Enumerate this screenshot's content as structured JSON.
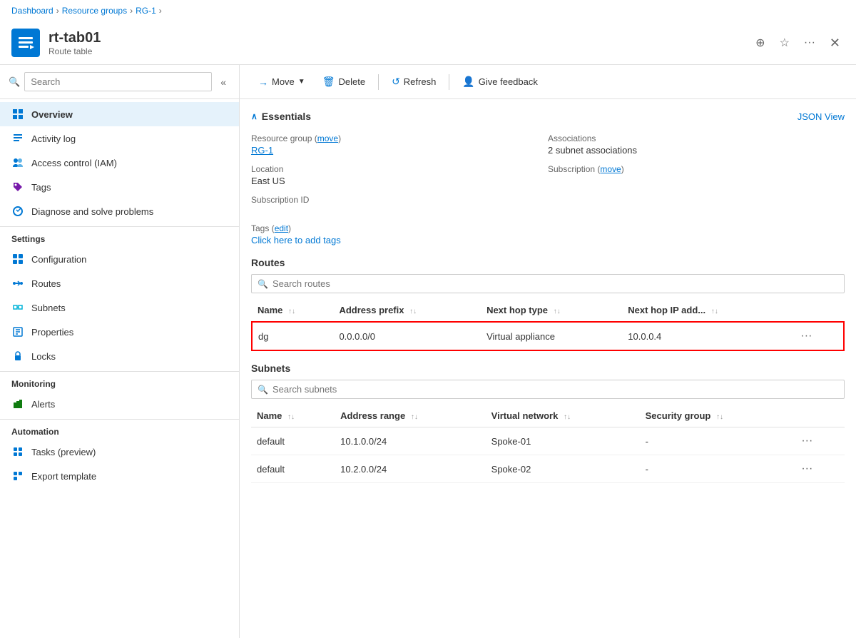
{
  "breadcrumb": {
    "items": [
      "Dashboard",
      "Resource groups",
      "RG-1"
    ],
    "separator": "›"
  },
  "resource": {
    "title": "rt-tab01",
    "subtitle": "Route table",
    "icon": "🗺"
  },
  "header_icons": {
    "favorite": "☆",
    "pin": "★",
    "ellipsis": "···",
    "close": "✕"
  },
  "toolbar": {
    "move_label": "Move",
    "delete_label": "Delete",
    "refresh_label": "Refresh",
    "feedback_label": "Give feedback"
  },
  "search": {
    "placeholder": "Search"
  },
  "sidebar": {
    "items": [
      {
        "id": "overview",
        "label": "Overview",
        "icon": "grid",
        "active": true
      },
      {
        "id": "activity-log",
        "label": "Activity log",
        "icon": "list"
      },
      {
        "id": "access-control",
        "label": "Access control (IAM)",
        "icon": "people"
      },
      {
        "id": "tags",
        "label": "Tags",
        "icon": "tag"
      },
      {
        "id": "diagnose",
        "label": "Diagnose and solve problems",
        "icon": "wrench"
      }
    ],
    "settings_label": "Settings",
    "settings_items": [
      {
        "id": "configuration",
        "label": "Configuration",
        "icon": "config"
      },
      {
        "id": "routes",
        "label": "Routes",
        "icon": "routes"
      },
      {
        "id": "subnets",
        "label": "Subnets",
        "icon": "subnet"
      },
      {
        "id": "properties",
        "label": "Properties",
        "icon": "properties"
      },
      {
        "id": "locks",
        "label": "Locks",
        "icon": "lock"
      }
    ],
    "monitoring_label": "Monitoring",
    "monitoring_items": [
      {
        "id": "alerts",
        "label": "Alerts",
        "icon": "alert"
      }
    ],
    "automation_label": "Automation",
    "automation_items": [
      {
        "id": "tasks",
        "label": "Tasks (preview)",
        "icon": "tasks"
      },
      {
        "id": "export",
        "label": "Export template",
        "icon": "export"
      }
    ]
  },
  "essentials": {
    "section_title": "Essentials",
    "json_view": "JSON View",
    "resource_group_label": "Resource group (move)",
    "resource_group_value": "RG-1",
    "associations_label": "Associations",
    "associations_value": "2 subnet associations",
    "location_label": "Location",
    "location_value": "East US",
    "subscription_label": "Subscription (move)",
    "subscription_value": "",
    "subscription_id_label": "Subscription ID",
    "subscription_id_value": "",
    "tags_label": "Tags (edit)",
    "tags_link": "Click here to add tags"
  },
  "routes": {
    "section_title": "Routes",
    "search_placeholder": "Search routes",
    "columns": [
      "Name",
      "Address prefix",
      "Next hop type",
      "Next hop IP add..."
    ],
    "rows": [
      {
        "name": "dg",
        "address_prefix": "0.0.0.0/0",
        "next_hop_type": "Virtual appliance",
        "next_hop_ip": "10.0.0.4",
        "highlighted": true
      }
    ]
  },
  "subnets": {
    "section_title": "Subnets",
    "search_placeholder": "Search subnets",
    "columns": [
      "Name",
      "Address range",
      "Virtual network",
      "Security group"
    ],
    "rows": [
      {
        "name": "default",
        "address_range": "10.1.0.0/24",
        "virtual_network": "Spoke-01",
        "security_group": "-"
      },
      {
        "name": "default",
        "address_range": "10.2.0.0/24",
        "virtual_network": "Spoke-02",
        "security_group": "-"
      }
    ]
  }
}
